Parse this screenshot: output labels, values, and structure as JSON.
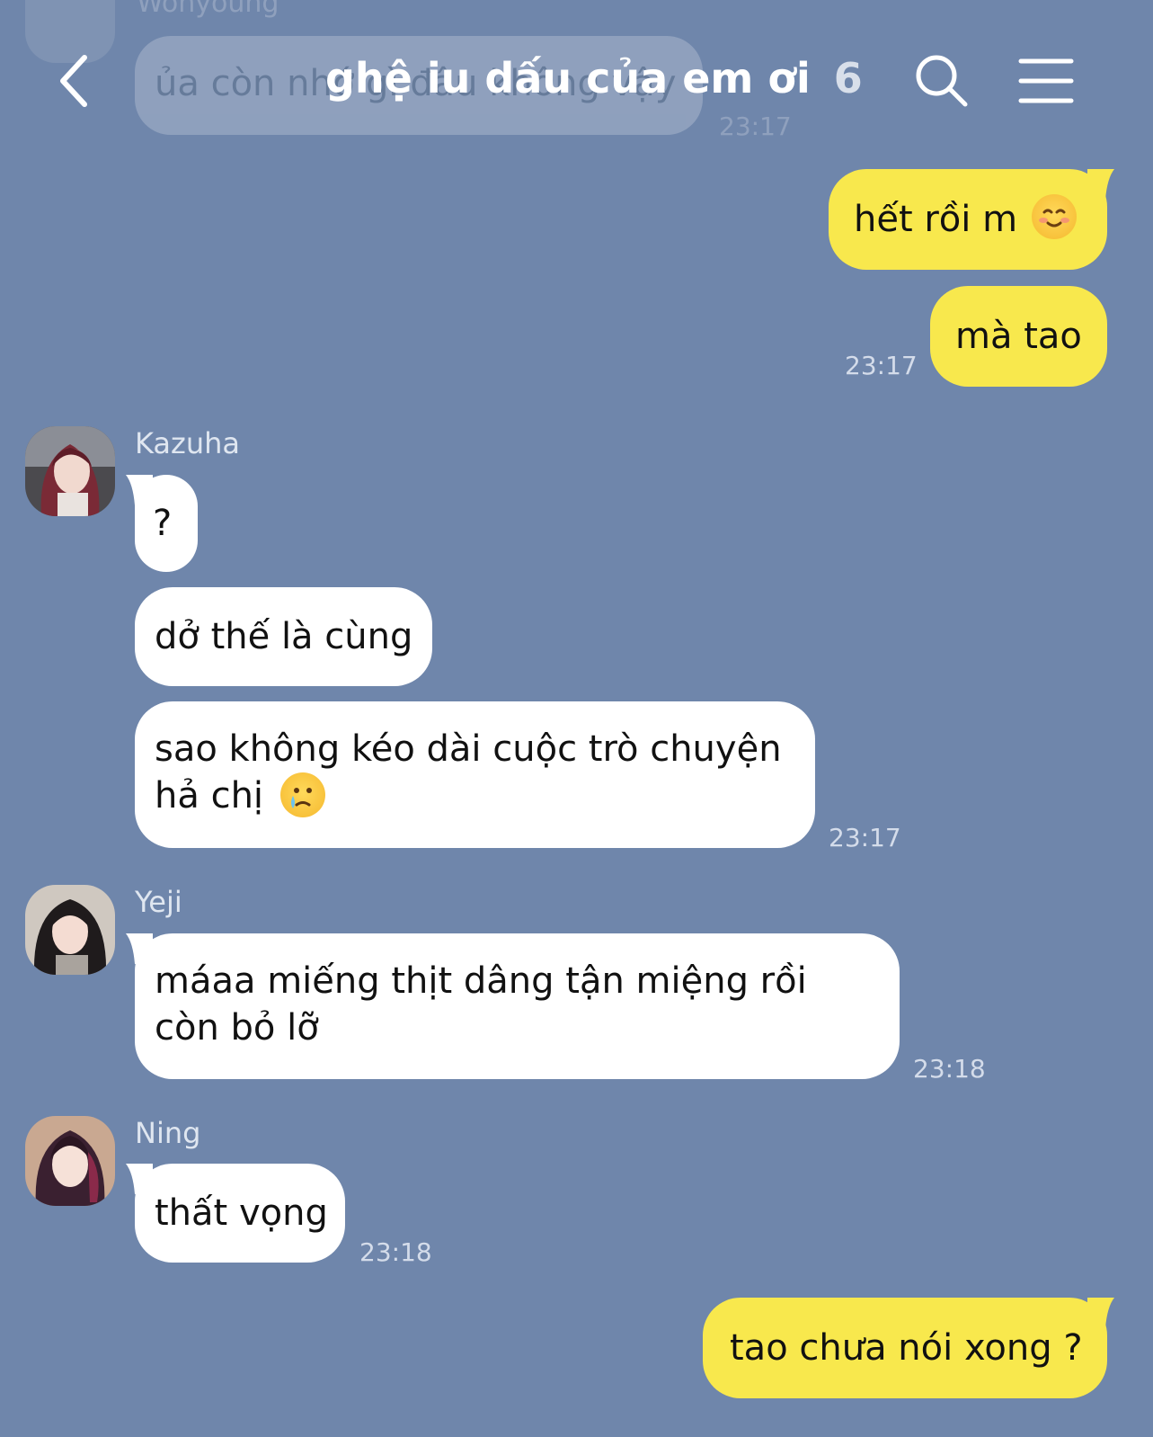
{
  "ghost_message": {
    "sender": "Wonyoung",
    "text": "ủa còn nhớ gì đâu không vậy",
    "time": "23:17"
  },
  "header": {
    "title": "ghệ iu dấu của em ơi",
    "member_count": "6"
  },
  "messages": [
    {
      "text": "hết rồi m",
      "emoji": "smiling-face-icon"
    },
    {
      "text": "mà tao",
      "time": "23:17"
    },
    {
      "sender": "Kazuha",
      "text": "?"
    },
    {
      "text": "dở thế là cùng"
    },
    {
      "text": "sao không kéo dài cuộc trò chuyện hả chị",
      "emoji": "crying-face-icon",
      "time": "23:17"
    },
    {
      "sender": "Yeji",
      "text": "máaa miếng thịt dâng tận miệng rồi còn bỏ lỡ",
      "time": "23:18"
    },
    {
      "sender": "Ning",
      "text": "thất vọng",
      "time": "23:18"
    },
    {
      "text": "tao chưa nói xong ?"
    }
  ],
  "colors": {
    "background": "#6f86ab",
    "my_bubble": "#f8e84d",
    "their_bubble": "#ffffff"
  }
}
